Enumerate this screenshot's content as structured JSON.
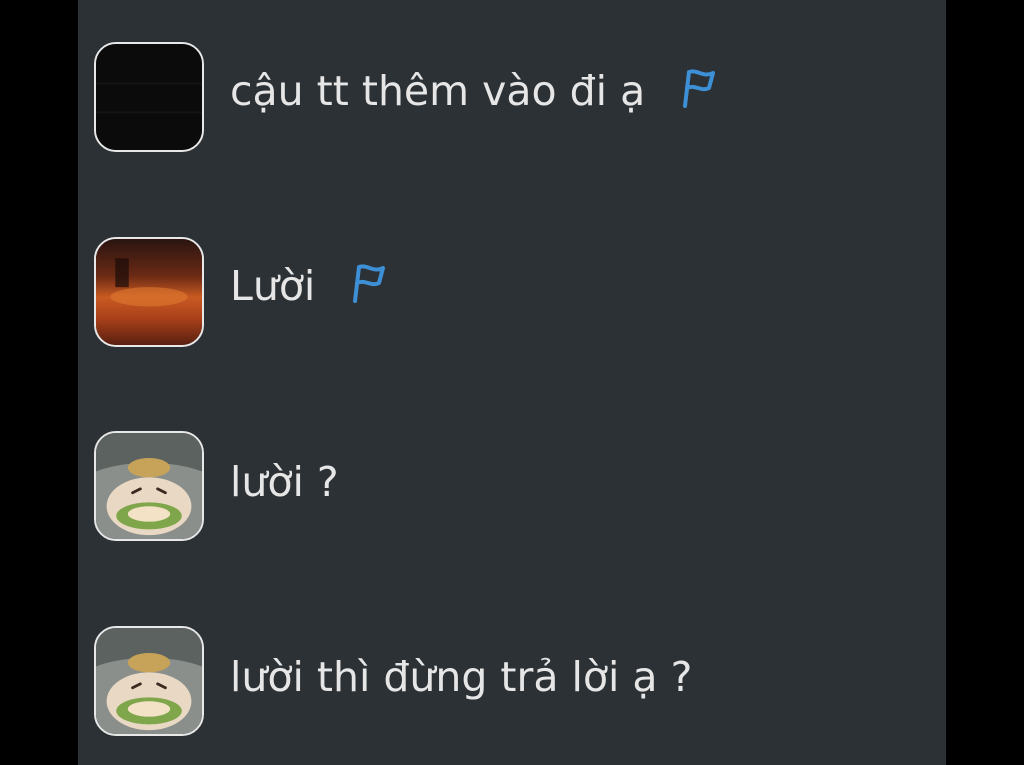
{
  "messages": [
    {
      "avatar": "black-avatar-icon",
      "text": "cậu tt thêm vào đi ạ",
      "flag": true
    },
    {
      "avatar": "fire-scene-avatar-icon",
      "text": "Lười",
      "flag": true
    },
    {
      "avatar": "cat-avatar-icon",
      "text": "lười ?",
      "flag": false
    },
    {
      "avatar": "cat-avatar-icon",
      "text": "lười thì đừng trả lời ạ ?",
      "flag": false
    }
  ],
  "colors": {
    "panel_bg": "#2c3135",
    "outer_bg": "#000000",
    "text": "#e6e6e6",
    "flag": "#3d8fd6",
    "avatar_border": "#e8e8e8"
  },
  "icons": {
    "flag": "report-flag-icon"
  }
}
